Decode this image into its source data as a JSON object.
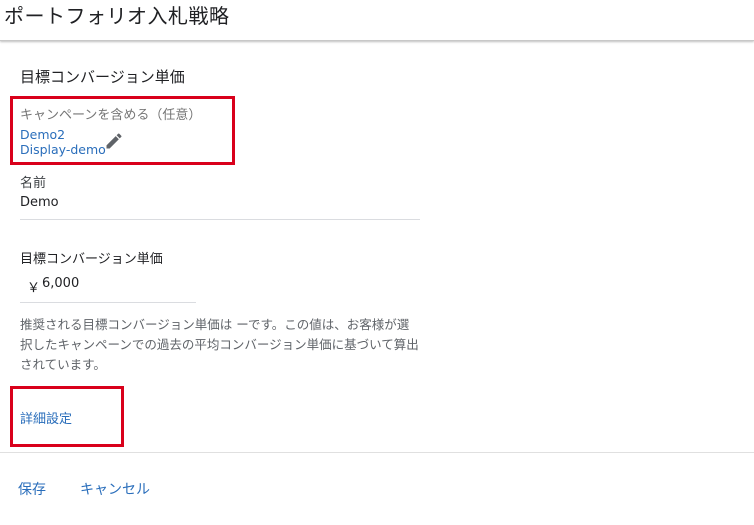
{
  "header": {
    "title": "ポートフォリオ入札戦略"
  },
  "form": {
    "section_title": "目標コンバージョン単価",
    "campaigns": {
      "label": "キャンペーンを含める（任意）",
      "items": [
        "Demo2",
        "Display-demo"
      ]
    },
    "name": {
      "label": "名前",
      "value": "Demo"
    },
    "target_cpa": {
      "label": "目標コンバージョン単価",
      "currency": "￥",
      "value": "6,000"
    },
    "help_text": "推奨される目標コンバージョン単価は ーです。この値は、お客様が選択したキャンペーンでの過去の平均コンバージョン単価に基づいて算出されています。",
    "advanced_settings": "詳細設定"
  },
  "footer": {
    "save_label": "保存",
    "cancel_label": "キャンセル"
  },
  "colors": {
    "link": "#2a6ebb",
    "highlight": "#d9001b"
  },
  "icons": {
    "edit": "pencil-icon"
  }
}
